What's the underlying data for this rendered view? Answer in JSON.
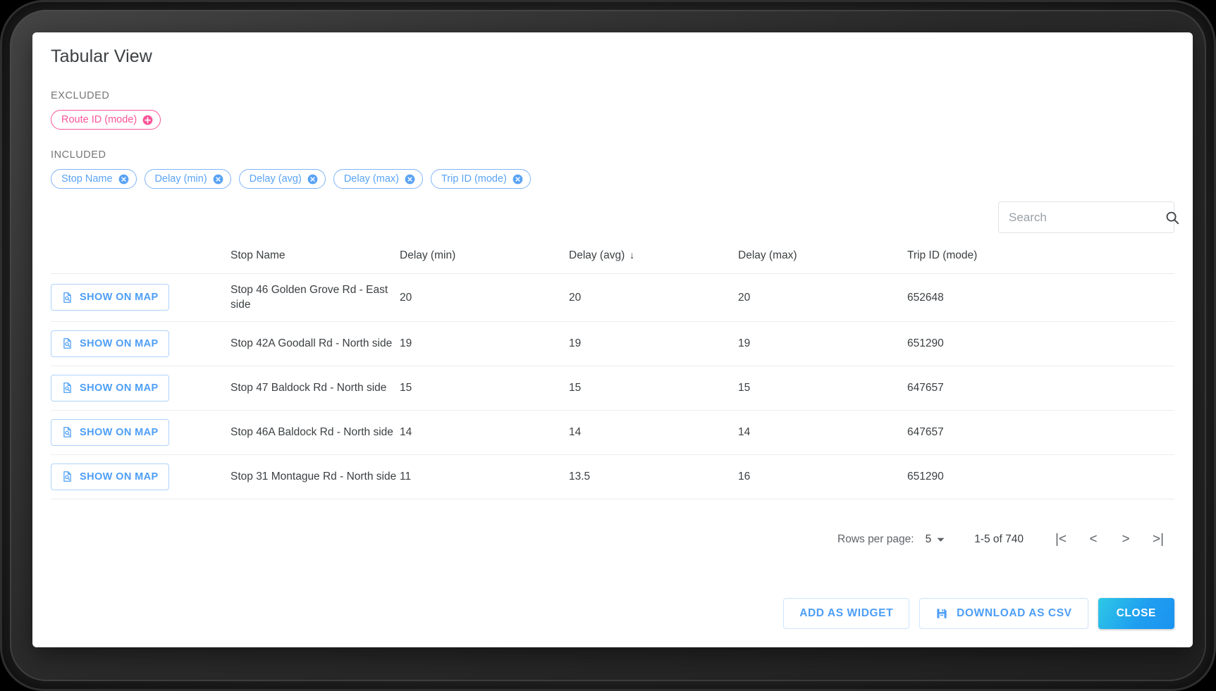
{
  "dialog": {
    "title": "Tabular View"
  },
  "fields": {
    "excluded_label": "EXCLUDED",
    "included_label": "INCLUDED",
    "excluded": [
      {
        "label": "Route ID (mode)",
        "icon": "plus-circle-icon"
      }
    ],
    "included": [
      {
        "label": "Stop Name",
        "icon": "remove-circle-icon"
      },
      {
        "label": "Delay (min)",
        "icon": "remove-circle-icon"
      },
      {
        "label": "Delay (avg)",
        "icon": "remove-circle-icon"
      },
      {
        "label": "Delay (max)",
        "icon": "remove-circle-icon"
      },
      {
        "label": "Trip ID (mode)",
        "icon": "remove-circle-icon"
      }
    ]
  },
  "search": {
    "placeholder": "Search",
    "value": "",
    "icon": "search-icon"
  },
  "table": {
    "action_label": "SHOW ON MAP",
    "action_icon": "map-document-icon",
    "columns": [
      {
        "key": "action",
        "label": ""
      },
      {
        "key": "stop_name",
        "label": "Stop Name"
      },
      {
        "key": "delay_min",
        "label": "Delay (min)"
      },
      {
        "key": "delay_avg",
        "label": "Delay (avg)"
      },
      {
        "key": "delay_max",
        "label": "Delay (max)"
      },
      {
        "key": "trip_id",
        "label": "Trip ID (mode)"
      }
    ],
    "sorted_by": "Delay (avg)",
    "sort_direction": "desc",
    "sort_arrow": "↓",
    "rows": [
      {
        "stop_name": "Stop 46 Golden Grove Rd - East side",
        "delay_min": "20",
        "delay_avg": "20",
        "delay_max": "20",
        "trip_id": "652648"
      },
      {
        "stop_name": "Stop 42A Goodall Rd - North side",
        "delay_min": "19",
        "delay_avg": "19",
        "delay_max": "19",
        "trip_id": "651290"
      },
      {
        "stop_name": "Stop 47 Baldock Rd - North side",
        "delay_min": "15",
        "delay_avg": "15",
        "delay_max": "15",
        "trip_id": "647657"
      },
      {
        "stop_name": "Stop 46A Baldock Rd - North side",
        "delay_min": "14",
        "delay_avg": "14",
        "delay_max": "14",
        "trip_id": "647657"
      },
      {
        "stop_name": "Stop 31 Montague Rd - North side",
        "delay_min": "11",
        "delay_avg": "13.5",
        "delay_max": "16",
        "trip_id": "651290"
      }
    ]
  },
  "pagination": {
    "rows_per_page_label": "Rows per page:",
    "rows_per_page_value": "5",
    "range_label": "1-5 of 740",
    "first_icon": "|<",
    "prev_icon": "<",
    "next_icon": ">",
    "last_icon": ">|"
  },
  "footer": {
    "add_widget_label": "ADD AS WIDGET",
    "download_csv_label": "DOWNLOAD AS CSV",
    "download_csv_icon": "save-disk-icon",
    "close_label": "CLOSE"
  },
  "colors": {
    "excluded_chip": "#f8559a",
    "included_chip": "#5aa3f5",
    "accent_blue": "#4d9ef6",
    "close_gradient_start": "#2ec8e6",
    "close_gradient_end": "#1c93f0"
  }
}
